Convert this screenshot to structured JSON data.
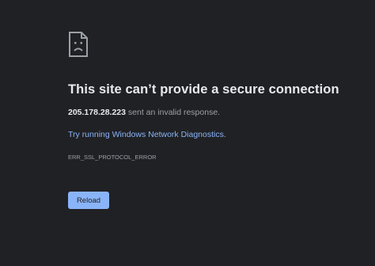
{
  "error_page": {
    "icon": "sad-page-icon",
    "title": "This site can’t provide a secure connection",
    "host": "205.178.28.223",
    "detail_suffix": " sent an invalid response.",
    "diagnostics_link": "Try running Windows Network Diagnostics.",
    "error_code": "ERR_SSL_PROTOCOL_ERROR",
    "reload_label": "Reload"
  },
  "colors": {
    "background": "#202124",
    "heading": "#e8eaed",
    "body_text": "#9aa0a6",
    "link": "#8ab4f8",
    "button_bg": "#8ab4f8",
    "button_text": "#202124"
  }
}
